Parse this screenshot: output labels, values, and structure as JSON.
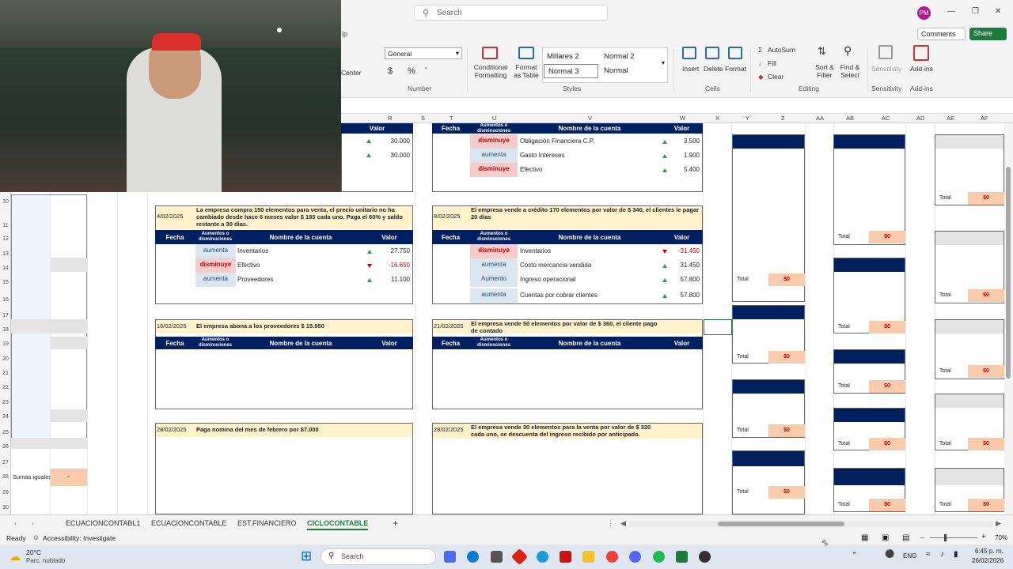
{
  "app": {
    "search_placeholder": "Search",
    "avatar_initials": "PM",
    "tab_fragment": "lp"
  },
  "ribbon": {
    "comments": "Comments",
    "share": "Share",
    "align_center": "Center",
    "number_format": "General",
    "number_group": "Number",
    "conditional_formatting": "Conditional Formatting",
    "format_as_table": "Format as Table",
    "styles": [
      "Millares 2",
      "Normal 2",
      "Normal 3",
      "Normal"
    ],
    "styles_group": "Styles",
    "insert": "Insert",
    "delete": "Delete",
    "format": "Format",
    "cells_group": "Cells",
    "autosum": "AutoSum",
    "fill": "Fill",
    "clear": "Clear",
    "sort_filter": "Sort & Filter",
    "find_select": "Find & Select",
    "editing_group": "Editing",
    "sensitivity": "Sensitivity",
    "sensitivity_group": "Sensitivity",
    "addins": "Add-ins",
    "addins_group": "Add-ins"
  },
  "columns": [
    "R",
    "S",
    "T",
    "U",
    "V",
    "W",
    "X",
    "Y",
    "Z",
    "AA",
    "AB",
    "AC",
    "AD",
    "AE",
    "AF"
  ],
  "rows": [
    "10",
    "11",
    "12",
    "13",
    "14",
    "15",
    "16",
    "17",
    "18",
    "19",
    "20",
    "21",
    "22",
    "23",
    "24",
    "25",
    "26",
    "27",
    "28",
    "29",
    "30"
  ],
  "headers": {
    "fecha": "Fecha",
    "aumentos": "Aumentos o disminuciones",
    "cuenta": "Nombre de la cuenta",
    "valor": "Valor"
  },
  "block_top_left": {
    "rows": [
      {
        "valor": "30.000"
      },
      {
        "valor": "30.000"
      }
    ]
  },
  "block_top_right": {
    "rows": [
      {
        "mov": "disminuye",
        "cuenta": "Obligación Financiera C.P.",
        "valor": "3.500"
      },
      {
        "mov": "aumenta",
        "cuenta": "Gasto Intereses",
        "valor": "1.900"
      },
      {
        "mov": "disminuye",
        "cuenta": "Efectivo",
        "valor": "5.400"
      }
    ]
  },
  "block_a": {
    "date": "4/02/2025",
    "desc": "La empresa compra 150 elementos para venta, el precio unitario no ha cambiado desde hace 6 meses valor $ 185 cada uno. Paga el 60% y saldo restante a 30 días.",
    "rows": [
      {
        "mov": "aumenta",
        "cuenta": "Inventarios",
        "valor": "27.750"
      },
      {
        "mov": "disminuye",
        "cuenta": "Efectivo",
        "valor": "-16.650"
      },
      {
        "mov": "aumenta",
        "cuenta": "Proveedores",
        "valor": "11.100"
      }
    ]
  },
  "block_b": {
    "date": "8/02/2025",
    "desc": "El empresa vende a crédito 170 elementos por valor de $ 340, el clientes le pagar 20 días",
    "rows": [
      {
        "mov": "disminuye",
        "cuenta": "Inventarios",
        "valor": "-31.450"
      },
      {
        "mov": "aumenta",
        "cuenta": "Costo mercancia vendida",
        "valor": "31.450"
      },
      {
        "mov": "Aumento",
        "cuenta": "Ingreso operacional",
        "valor": "57.800"
      },
      {
        "mov": "aumenta",
        "cuenta": "Cuentas por cobrar clientes",
        "valor": "57.800"
      }
    ]
  },
  "block_c": {
    "date": "16/02/2025",
    "desc": "El empresa abona a los proveedores $ 15.950"
  },
  "block_d": {
    "date": "21/02/2025",
    "desc": "El empresa vende 50 elementos por valor de $ 360, el cliente pago de contado"
  },
  "block_e": {
    "date": "28/02/2025",
    "desc": "Paga nomina del mes de febrero por $7.000"
  },
  "block_f": {
    "date": "28/02/2025",
    "desc": "El empresa vende 30 elementos para la venta por valor de $ 320 cada uno, se descuenta del ingreso recibido por anticipado."
  },
  "totals": {
    "label": "Total",
    "value": "$0"
  },
  "left_panel": {
    "sumas": "Sumas iguales",
    "sumas_value": "-"
  },
  "sheets": [
    "ECUACIONCONTABL1",
    "ECUACIONCONTABLE",
    "EST.FINANCIERO",
    "CICLOCONTABLE"
  ],
  "status": {
    "ready": "Ready",
    "accessibility": "Accessibility: Investigate",
    "zoom": "70%"
  },
  "taskbar": {
    "temp": "20°C",
    "weather": "Parc. nublado",
    "search": "Search",
    "lang": "ENG",
    "time": "6:45 p. m.",
    "date": "26/02/2026"
  }
}
